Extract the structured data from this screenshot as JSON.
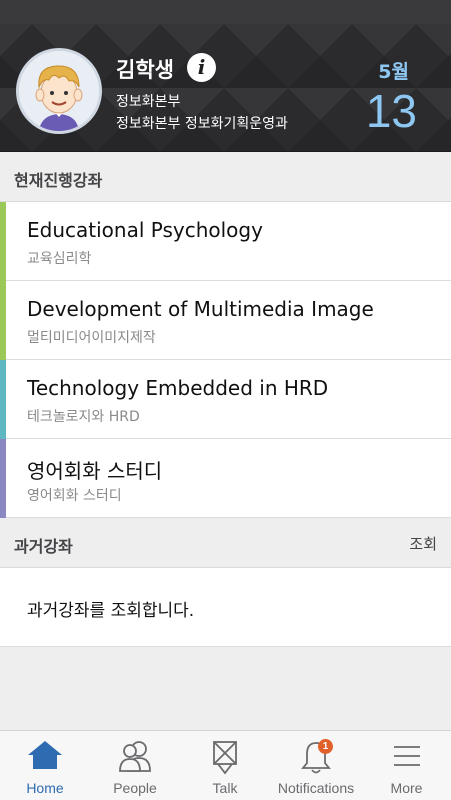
{
  "profile": {
    "name": "김학생",
    "department": "정보화본부",
    "division": "정보화본부 정보화기획운영과"
  },
  "date": {
    "month": "5월",
    "day": "13"
  },
  "current": {
    "title": "현재진행강좌",
    "courses": [
      {
        "title": "Educational Psychology",
        "subtitle": "교육심리학",
        "color": "#9cc85a"
      },
      {
        "title": "Development of Multimedia Image",
        "subtitle": "멀티미디어이미지제작",
        "color": "#9cc85a"
      },
      {
        "title": "Technology Embedded in HRD",
        "subtitle": "테크놀로지와 HRD",
        "color": "#5fb7c2"
      },
      {
        "title": "영어회화 스터디",
        "subtitle": "영어회화 스터디",
        "color": "#8a87c2"
      }
    ]
  },
  "past": {
    "title": "과거강좌",
    "action": "조회",
    "message": "과거강좌를 조회합니다."
  },
  "tabs": [
    {
      "label": "Home",
      "icon": "home-icon",
      "active": true
    },
    {
      "label": "People",
      "icon": "people-icon"
    },
    {
      "label": "Talk",
      "icon": "talk-icon"
    },
    {
      "label": "Notifications",
      "icon": "bell-icon",
      "badge": "1"
    },
    {
      "label": "More",
      "icon": "menu-icon"
    }
  ],
  "colors": {
    "accent": "#2f6bb0",
    "date": "#8ec8f2",
    "badge": "#e0612b"
  }
}
